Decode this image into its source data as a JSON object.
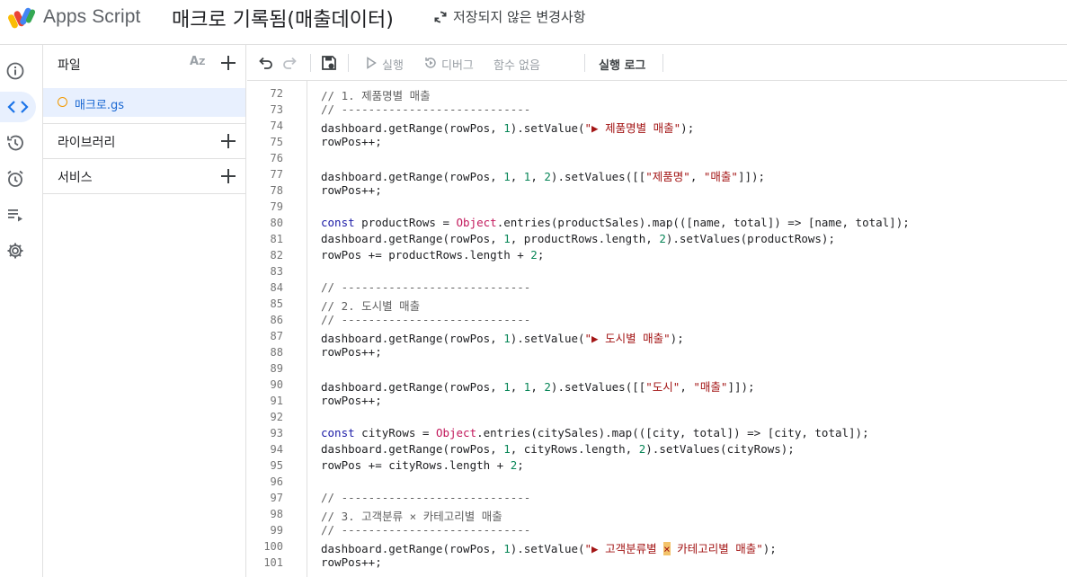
{
  "header": {
    "app_name": "Apps Script",
    "project_title": "매크로 기록됨(매출데이터)",
    "unsaved_status": "저장되지 않은 변경사항"
  },
  "files_panel": {
    "title": "파일",
    "files": [
      {
        "name": "매크로.gs"
      }
    ],
    "libraries_label": "라이브러리",
    "services_label": "서비스"
  },
  "toolbar": {
    "run_label": "실행",
    "debug_label": "디버그",
    "function_select": "함수 없음",
    "exec_log_label": "실행 로그"
  },
  "editor": {
    "lines": [
      {
        "n": "72",
        "t": "// 1. 제품명별 매출"
      },
      {
        "n": "73",
        "t": "// ----------------------------"
      },
      {
        "n": "74",
        "t": "dashboard.getRange(rowPos, 1).setValue(\"▶ 제품명별 매출\");"
      },
      {
        "n": "75",
        "t": "rowPos++;"
      },
      {
        "n": "76",
        "t": ""
      },
      {
        "n": "77",
        "t": "dashboard.getRange(rowPos, 1, 1, 2).setValues([[\"제품명\", \"매출\"]]);"
      },
      {
        "n": "78",
        "t": "rowPos++;"
      },
      {
        "n": "79",
        "t": ""
      },
      {
        "n": "80",
        "t": "const productRows = Object.entries(productSales).map(([name, total]) => [name, total]);"
      },
      {
        "n": "81",
        "t": "dashboard.getRange(rowPos, 1, productRows.length, 2).setValues(productRows);"
      },
      {
        "n": "82",
        "t": "rowPos += productRows.length + 2;"
      },
      {
        "n": "83",
        "t": ""
      },
      {
        "n": "84",
        "t": "// ----------------------------"
      },
      {
        "n": "85",
        "t": "// 2. 도시별 매출"
      },
      {
        "n": "86",
        "t": "// ----------------------------"
      },
      {
        "n": "87",
        "t": "dashboard.getRange(rowPos, 1).setValue(\"▶ 도시별 매출\");"
      },
      {
        "n": "88",
        "t": "rowPos++;"
      },
      {
        "n": "89",
        "t": ""
      },
      {
        "n": "90",
        "t": "dashboard.getRange(rowPos, 1, 1, 2).setValues([[\"도시\", \"매출\"]]);"
      },
      {
        "n": "91",
        "t": "rowPos++;"
      },
      {
        "n": "92",
        "t": ""
      },
      {
        "n": "93",
        "t": "const cityRows = Object.entries(citySales).map(([city, total]) => [city, total]);"
      },
      {
        "n": "94",
        "t": "dashboard.getRange(rowPos, 1, cityRows.length, 2).setValues(cityRows);"
      },
      {
        "n": "95",
        "t": "rowPos += cityRows.length + 2;"
      },
      {
        "n": "96",
        "t": ""
      },
      {
        "n": "97",
        "t": "// ----------------------------"
      },
      {
        "n": "98",
        "t": "// 3. 고객분류 × 카테고리별 매출"
      },
      {
        "n": "99",
        "t": "// ----------------------------"
      },
      {
        "n": "100",
        "t": "dashboard.getRange(rowPos, 1).setValue(\"▶ 고객분류별 × 카테고리별 매출\");"
      },
      {
        "n": "101",
        "t": "rowPos++;"
      }
    ]
  },
  "colors": {
    "accent": "#1a73e8",
    "selected_bg": "#e8f0fe",
    "file_dot": "#f29900",
    "string": "#a31515",
    "number": "#098658",
    "keyword": "#1a1aa6",
    "comment": "#616161"
  }
}
